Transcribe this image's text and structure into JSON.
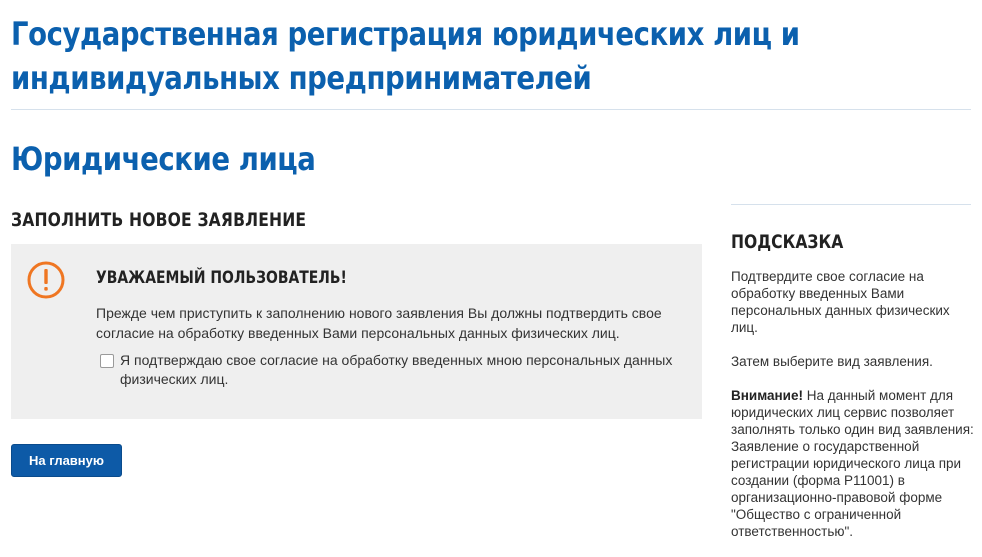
{
  "page": {
    "title_line1": "Государственная регистрация юридических лиц и",
    "title_line2": "индивидуальных предпринимателей",
    "section_title": "Юридические лица",
    "form_heading": "ЗАПОЛНИТЬ НОВОЕ ЗАЯВЛЕНИЕ"
  },
  "notice": {
    "icon": "exclamation-circle-icon",
    "icon_color": "#ef7622",
    "title": "УВАЖАЕМЫЙ ПОЛЬЗОВАТЕЛЬ!",
    "text": "Прежде чем приступить к заполнению нового заявления Вы должны подтвердить свое согласие на обработку введенных Вами персональных данных физических лиц.",
    "consent_label": "Я подтверждаю свое согласие на обработку введенных мною персональных данных физических лиц.",
    "consent_checked": false
  },
  "actions": {
    "home_button": "На главную"
  },
  "sidebar": {
    "title": "ПОДСКАЗКА",
    "p1": "Подтвердите свое согласие на обработку введенных Вами персональных данных физических лиц.",
    "p2": "Затем выберите вид заявления.",
    "p3_bold": "Внимание!",
    "p3_text": " На данный момент для юридических лиц сервис позволяет заполнять только один вид заявления: Заявление о государственной регистрации юридического лица при создании (форма Р11001) в организационно-правовой форме \"Общество с ограниченной ответственностью\"."
  },
  "colors": {
    "brand_blue": "#0b60ae",
    "button_blue": "#0d5aa7",
    "notice_bg": "#efefef"
  }
}
